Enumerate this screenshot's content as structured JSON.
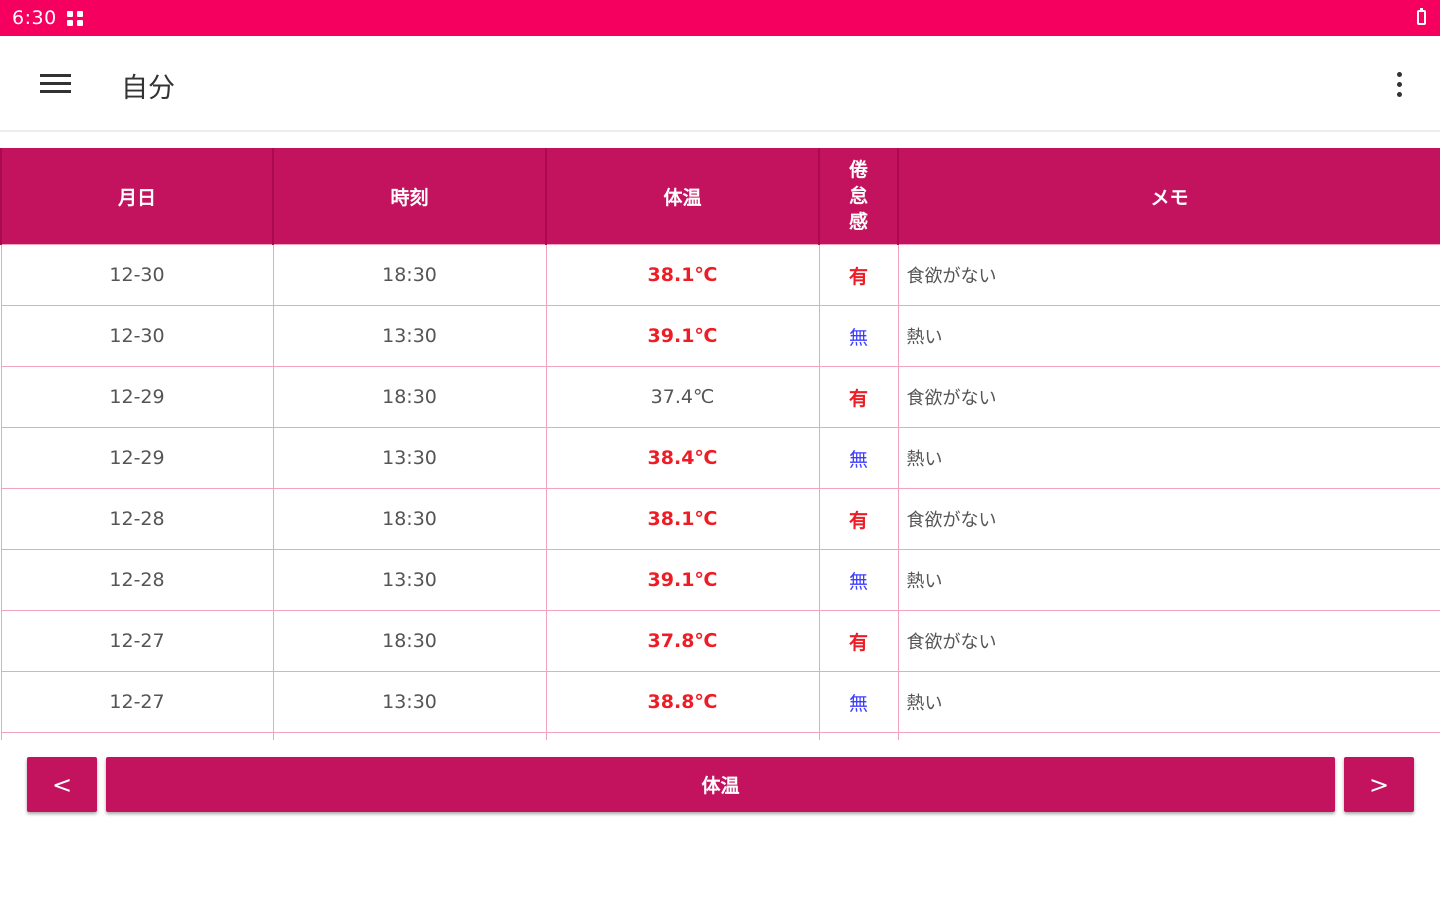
{
  "status_bar": {
    "time": "6:30"
  },
  "app_bar": {
    "title": "自分"
  },
  "table": {
    "headers": {
      "date": "月日",
      "time": "時刻",
      "temp": "体温",
      "fatigue": "倦怠感",
      "memo": "メモ"
    },
    "rows": [
      {
        "date": "12-30",
        "time": "18:30",
        "temp": "38.1℃",
        "fatigue": "有",
        "memo": "食欲がない"
      },
      {
        "date": "12-30",
        "time": "13:30",
        "temp": "39.1℃",
        "fatigue": "無",
        "memo": "熱い"
      },
      {
        "date": "12-29",
        "time": "18:30",
        "temp": "37.4℃",
        "fatigue": "有",
        "memo": "食欲がない"
      },
      {
        "date": "12-29",
        "time": "13:30",
        "temp": "38.4℃",
        "fatigue": "無",
        "memo": "熱い"
      },
      {
        "date": "12-28",
        "time": "18:30",
        "temp": "38.1℃",
        "fatigue": "有",
        "memo": "食欲がない"
      },
      {
        "date": "12-28",
        "time": "13:30",
        "temp": "39.1℃",
        "fatigue": "無",
        "memo": "熱い"
      },
      {
        "date": "12-27",
        "time": "18:30",
        "temp": "37.8℃",
        "fatigue": "有",
        "memo": "食欲がない"
      },
      {
        "date": "12-27",
        "time": "13:30",
        "temp": "38.8℃",
        "fatigue": "無",
        "memo": "熱い"
      }
    ]
  },
  "footer": {
    "prev_label": "<",
    "main_label": "体温",
    "next_label": ">"
  },
  "colors": {
    "accent": "#c4135e",
    "status_bar": "#f5005f",
    "fever_text": "#ee1c25",
    "no_text": "#3d3dff"
  }
}
